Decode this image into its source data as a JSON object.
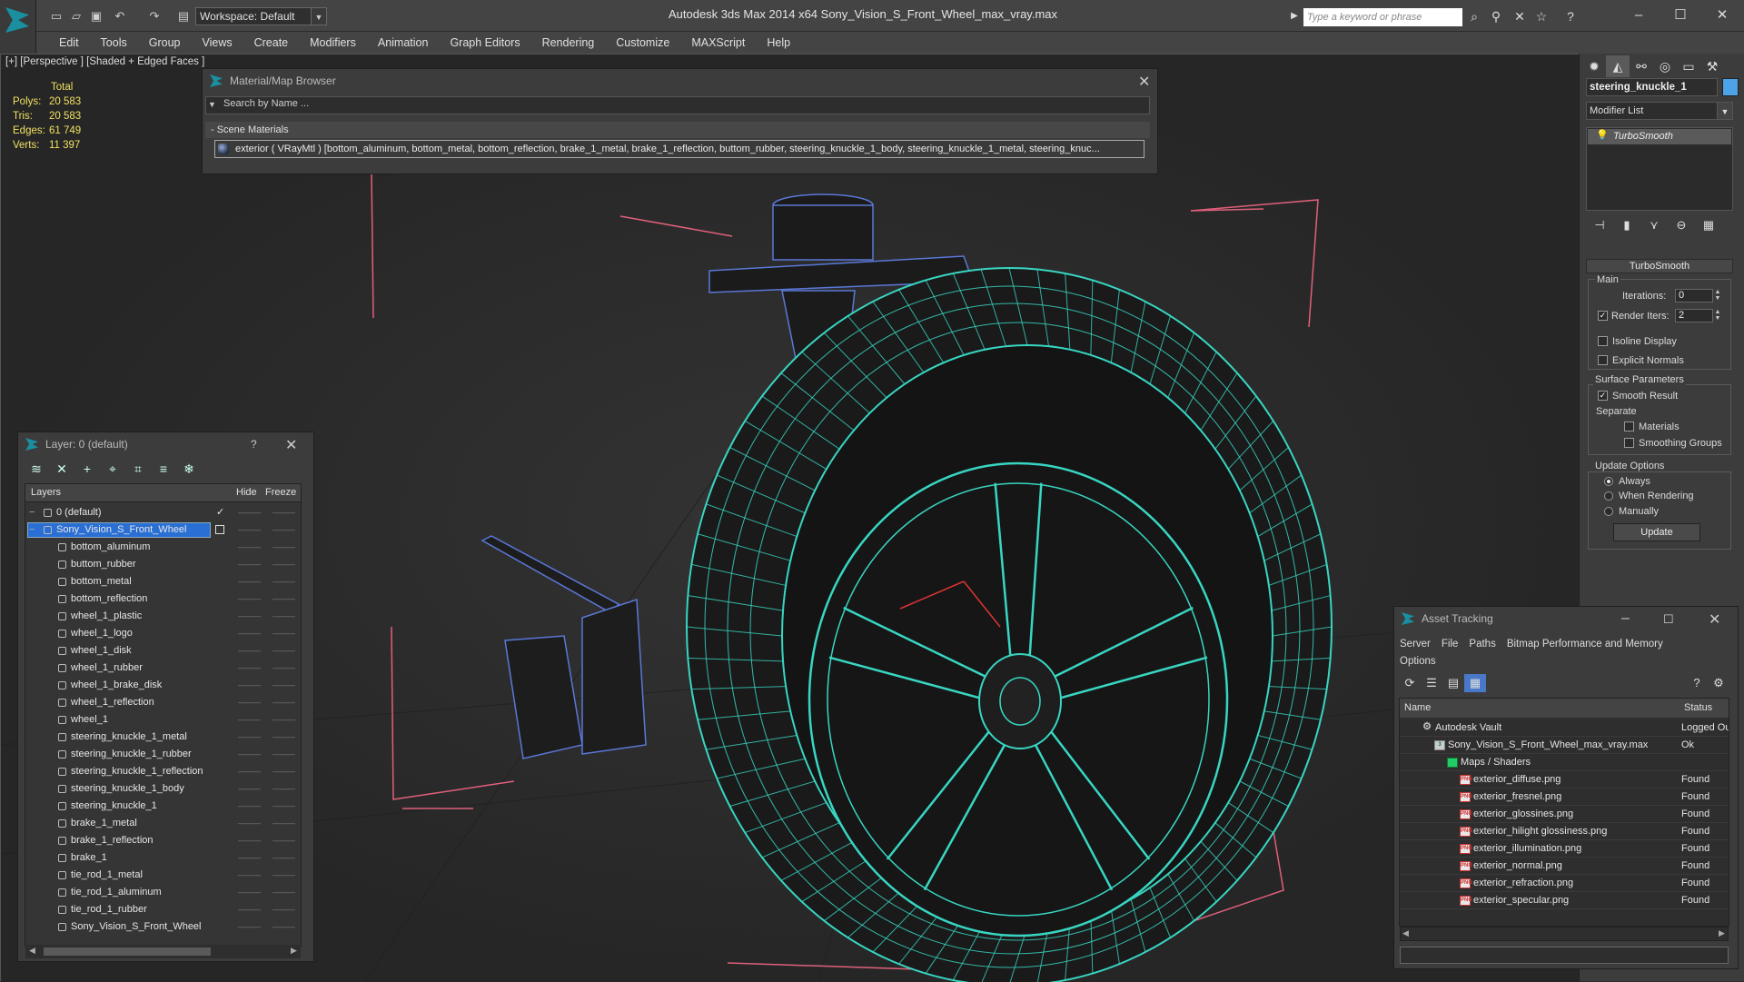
{
  "app": {
    "title": "Autodesk 3ds Max  2014 x64     Sony_Vision_S_Front_Wheel_max_vray.max",
    "workspace": "Workspace: Default",
    "search_placeholder": "Type a keyword or phrase"
  },
  "menu": [
    "Edit",
    "Tools",
    "Group",
    "Views",
    "Create",
    "Modifiers",
    "Animation",
    "Graph Editors",
    "Rendering",
    "Customize",
    "MAXScript",
    "Help"
  ],
  "viewport": {
    "label": "[+] [Perspective ] [Shaded + Edged Faces ]",
    "stats": {
      "header": "Total",
      "rows": [
        {
          "label": "Polys:",
          "value": "20 583"
        },
        {
          "label": "Tris:",
          "value": "20 583"
        },
        {
          "label": "Edges:",
          "value": "61 749"
        },
        {
          "label": "Verts:",
          "value": "11 397"
        }
      ]
    }
  },
  "material_browser": {
    "title": "Material/Map Browser",
    "search": "Search by Name ...",
    "group": "- Scene Materials",
    "row": "exterior  ( VRayMtl ) [bottom_aluminum, bottom_metal, bottom_reflection, brake_1_metal, brake_1_reflection, buttom_rubber, steering_knuckle_1_body, steering_knuckle_1_metal, steering_knuc..."
  },
  "layers": {
    "title": "Layer: 0 (default)",
    "help": "?",
    "col_layers": "Layers",
    "col_hide": "Hide",
    "col_freeze": "Freeze",
    "rows": [
      {
        "name": "0 (default)",
        "level": 0,
        "check": "✓"
      },
      {
        "name": "Sony_Vision_S_Front_Wheel",
        "level": 0,
        "selected": true
      },
      {
        "name": "bottom_aluminum",
        "level": 1
      },
      {
        "name": "buttom_rubber",
        "level": 1
      },
      {
        "name": "bottom_metal",
        "level": 1
      },
      {
        "name": "bottom_reflection",
        "level": 1
      },
      {
        "name": "wheel_1_plastic",
        "level": 1
      },
      {
        "name": "wheel_1_logo",
        "level": 1
      },
      {
        "name": "wheel_1_disk",
        "level": 1
      },
      {
        "name": "wheel_1_rubber",
        "level": 1
      },
      {
        "name": "wheel_1_brake_disk",
        "level": 1
      },
      {
        "name": "wheel_1_reflection",
        "level": 1
      },
      {
        "name": "wheel_1",
        "level": 1
      },
      {
        "name": "steering_knuckle_1_metal",
        "level": 1
      },
      {
        "name": "steering_knuckle_1_rubber",
        "level": 1
      },
      {
        "name": "steering_knuckle_1_reflection",
        "level": 1
      },
      {
        "name": "steering_knuckle_1_body",
        "level": 1
      },
      {
        "name": "steering_knuckle_1",
        "level": 1
      },
      {
        "name": "brake_1_metal",
        "level": 1
      },
      {
        "name": "brake_1_reflection",
        "level": 1
      },
      {
        "name": "brake_1",
        "level": 1
      },
      {
        "name": "tie_rod_1_metal",
        "level": 1
      },
      {
        "name": "tie_rod_1_aluminum",
        "level": 1
      },
      {
        "name": "tie_rod_1_rubber",
        "level": 1
      },
      {
        "name": "Sony_Vision_S_Front_Wheel",
        "level": 1
      }
    ]
  },
  "command_panel": {
    "object_name": "steering_knuckle_1",
    "object_color": "#4da3e8",
    "modifier_list": "Modifier List",
    "stack_item": "TurboSmooth",
    "turbosmooth": {
      "title": "TurboSmooth",
      "main": "Main",
      "iterations_label": "Iterations:",
      "iterations": "0",
      "render_iters_label": "Render Iters:",
      "render_iters": "2",
      "isoline": "Isoline Display",
      "explicit": "Explicit Normals",
      "surface": "Surface Parameters",
      "smooth_result": "Smooth Result",
      "separate": "Separate",
      "materials": "Materials",
      "smoothing_groups": "Smoothing Groups",
      "update_options": "Update Options",
      "always": "Always",
      "when_rendering": "When Rendering",
      "manually": "Manually",
      "update": "Update"
    }
  },
  "asset_tracking": {
    "title": "Asset Tracking",
    "menu": [
      "Server",
      "File",
      "Paths",
      "Bitmap Performance and Memory"
    ],
    "menu2": "Options",
    "col_name": "Name",
    "col_status": "Status",
    "rows": [
      {
        "name": "Autodesk Vault",
        "status": "Logged Out",
        "level": 0,
        "type": "vault"
      },
      {
        "name": "Sony_Vision_S_Front_Wheel_max_vray.max",
        "status": "Ok",
        "level": 1,
        "type": "max"
      },
      {
        "name": "Maps / Shaders",
        "status": "",
        "level": 2,
        "type": "folder"
      },
      {
        "name": "exterior_diffuse.png",
        "status": "Found",
        "level": 3,
        "type": "png"
      },
      {
        "name": "exterior_fresnel.png",
        "status": "Found",
        "level": 3,
        "type": "png"
      },
      {
        "name": "exterior_glossines.png",
        "status": "Found",
        "level": 3,
        "type": "png"
      },
      {
        "name": "exterior_hilight glossiness.png",
        "status": "Found",
        "level": 3,
        "type": "png"
      },
      {
        "name": "exterior_illumination.png",
        "status": "Found",
        "level": 3,
        "type": "png"
      },
      {
        "name": "exterior_normal.png",
        "status": "Found",
        "level": 3,
        "type": "png"
      },
      {
        "name": "exterior_refraction.png",
        "status": "Found",
        "level": 3,
        "type": "png"
      },
      {
        "name": "exterior_specular.png",
        "status": "Found",
        "level": 3,
        "type": "png"
      }
    ]
  },
  "colors": {
    "wire": "#38d6c2",
    "bbox": "#e0607a",
    "accent": "#1a8fa0",
    "stats": "#f0e060"
  }
}
